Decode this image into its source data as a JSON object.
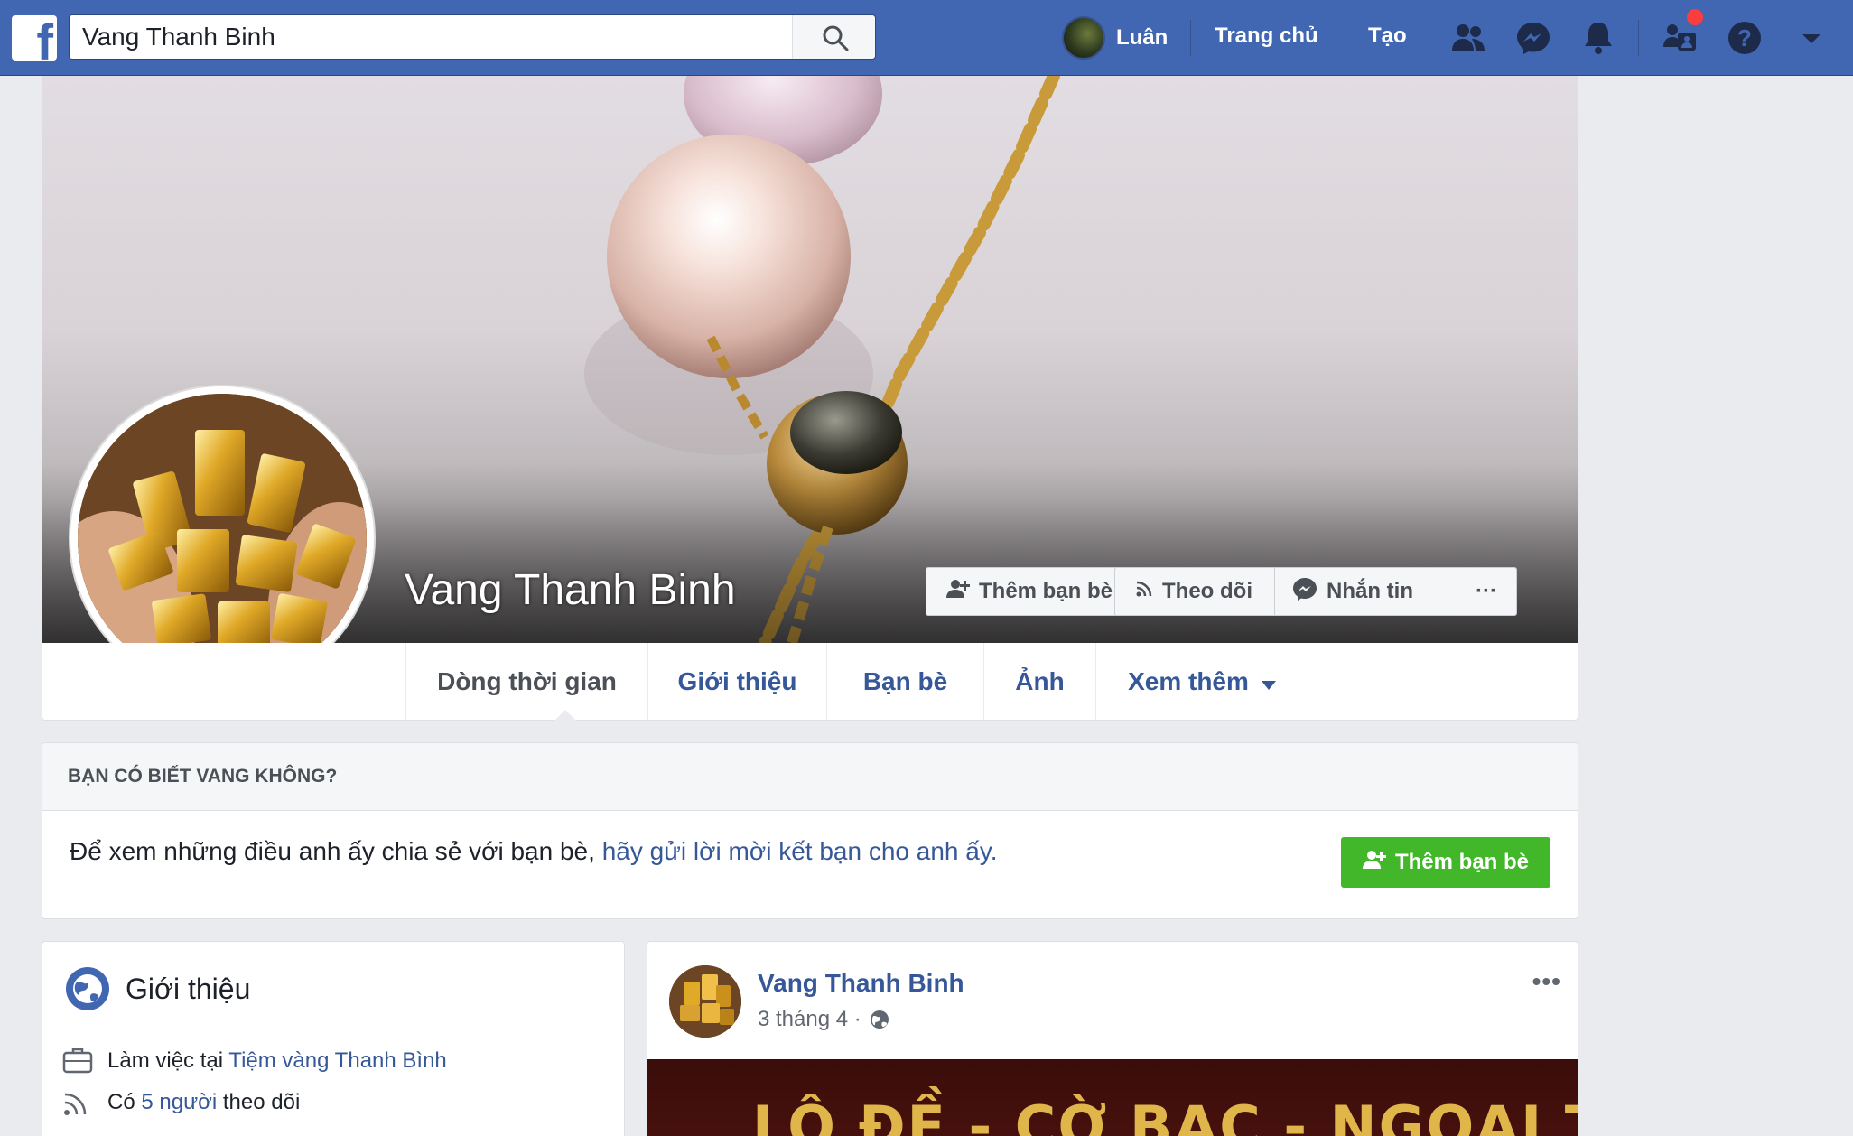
{
  "topbar": {
    "search_value": "Vang Thanh Binh",
    "user_name": "Luân",
    "home_label": "Trang chủ",
    "create_label": "Tạo"
  },
  "colors": {
    "brand_blue": "#4267b2",
    "link_blue": "#365899",
    "green": "#42b72a",
    "notification_red": "#fa3e3e"
  },
  "profile": {
    "name": "Vang Thanh Binh",
    "add_friend_label": "Thêm bạn bè",
    "follow_label": "Theo dõi",
    "message_label": "Nhắn tin",
    "more_label": "···"
  },
  "tabs": [
    {
      "label": "Dòng thời gian",
      "active": true
    },
    {
      "label": "Giới thiệu"
    },
    {
      "label": "Bạn bè"
    },
    {
      "label": "Ảnh"
    },
    {
      "label": "Xem thêm"
    }
  ],
  "know_card": {
    "header": "BẠN CÓ BIẾT VANG KHÔNG?",
    "text": "Để xem những điều anh ấy chia sẻ với bạn bè, ",
    "link": "hãy gửi lời mời kết bạn cho anh ấy.",
    "button": "Thêm bạn bè"
  },
  "intro": {
    "title": "Giới thiệu",
    "work_prefix": "Làm việc tại ",
    "work_link": "Tiệm vàng Thanh Bình",
    "followers_prefix": "Có ",
    "followers_link": "5 người",
    "followers_suffix": " theo dõi"
  },
  "post": {
    "author": "Vang Thanh Binh",
    "date": "3 tháng 4 ·",
    "more": "•••",
    "image_text": "LÔ ĐỀ - CỜ BẠC - NGOẠI TÌNH"
  }
}
